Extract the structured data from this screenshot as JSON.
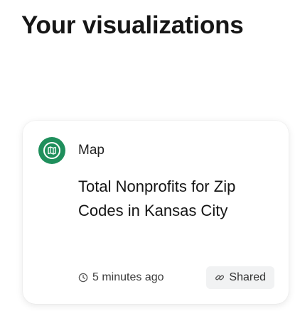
{
  "page": {
    "title": "Your visualizations"
  },
  "cards": [
    {
      "type_label": "Map",
      "type_icon": "map-icon",
      "icon_color": "#1f8f5c",
      "title": "Total Nonprofits for Zip Codes in Kansas City",
      "timestamp": "5 minutes ago",
      "timestamp_icon": "clock-icon",
      "badge": "Shared",
      "badge_icon": "link-icon"
    }
  ]
}
